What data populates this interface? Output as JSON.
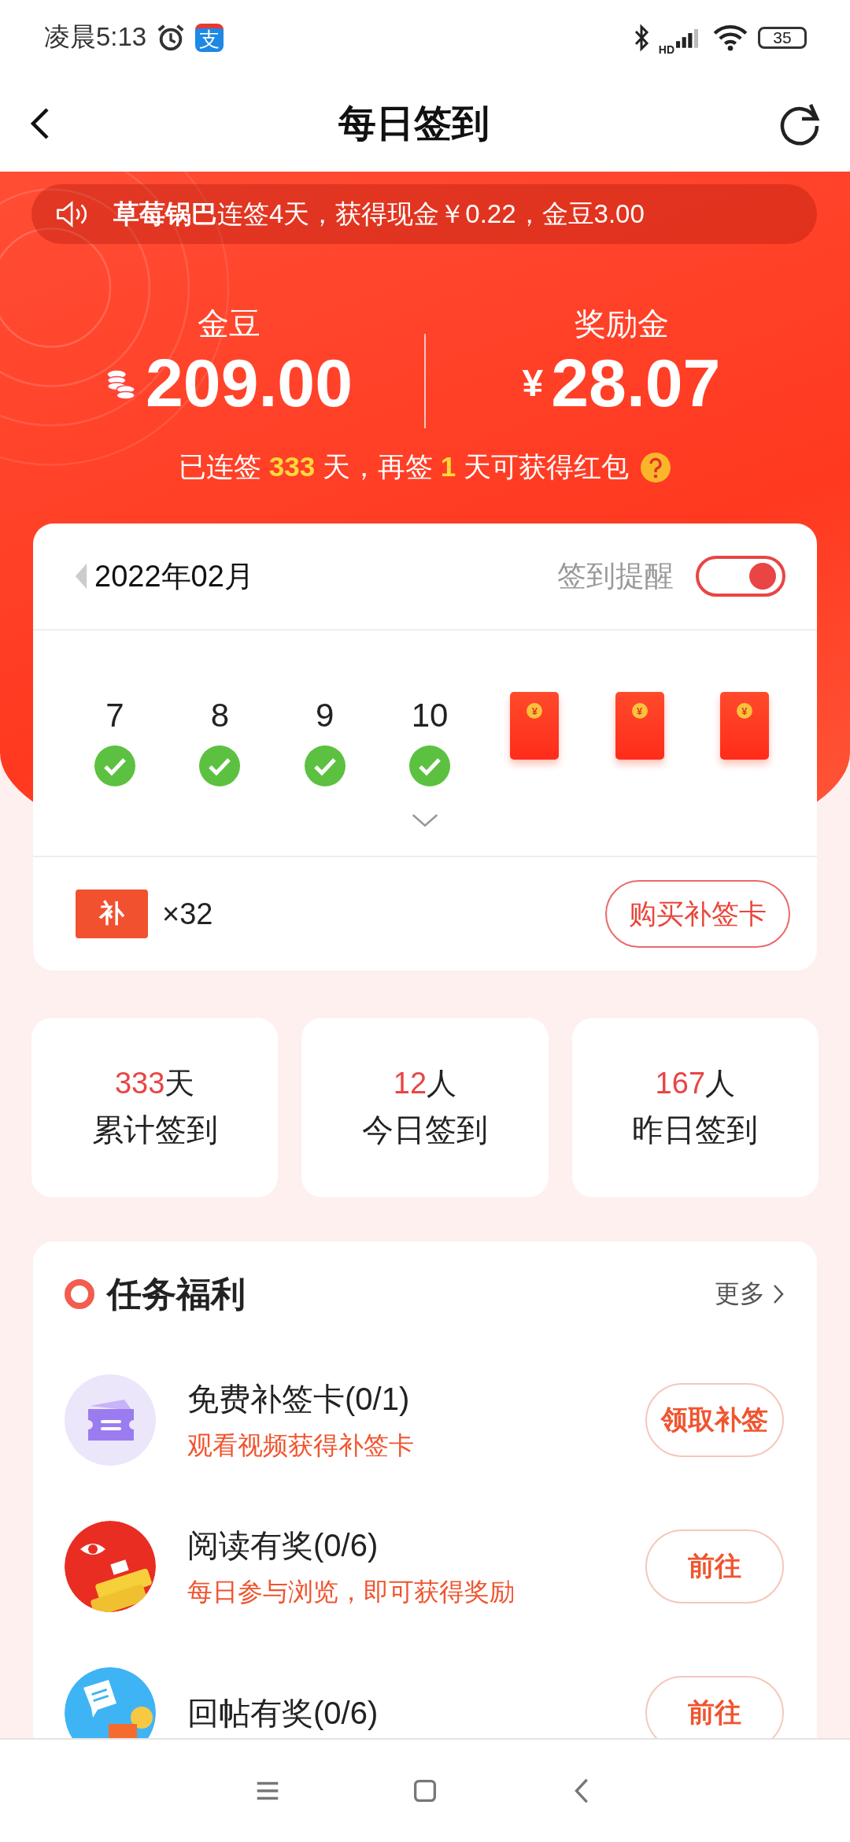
{
  "status_bar": {
    "time": "凌晨5:13",
    "app_icon_text": "支",
    "network_label": "HD",
    "battery": "35"
  },
  "header": {
    "title": "每日签到"
  },
  "ticker": {
    "text": "**草莓锅巴**连签4天，获得现金￥0.22，金豆3.00"
  },
  "balances": [
    {
      "kind": "coins",
      "label": "金豆",
      "value": "209.00"
    },
    {
      "kind": "cash",
      "label": "奖励金",
      "currency": "¥",
      "value": "28.07"
    }
  ],
  "streak": "已连签 **333** 天，再签 **1** 天可获得红包",
  "calendar": {
    "month": "2022年02月",
    "reminder_label": "签到提醒",
    "reminder_on": true,
    "days": [
      {
        "kind": "day",
        "day": "7",
        "checked": true
      },
      {
        "kind": "day",
        "day": "8",
        "checked": true
      },
      {
        "kind": "day",
        "day": "9",
        "checked": true
      },
      {
        "kind": "day",
        "day": "10",
        "checked": true
      },
      {
        "kind": "envelope",
        "symbol": "¥"
      },
      {
        "kind": "envelope",
        "symbol": "¥"
      },
      {
        "kind": "envelope",
        "symbol": "¥"
      }
    ],
    "makeup_card": {
      "icon_text": "补",
      "count": "×32",
      "button": "购买补签卡"
    }
  },
  "stats": [
    {
      "value": "333",
      "unit": "天",
      "label": "累计签到"
    },
    {
      "value": "12",
      "unit": "人",
      "label": "今日签到"
    },
    {
      "value": "167",
      "unit": "人",
      "label": "昨日签到"
    }
  ],
  "tasks": {
    "title": "任务福利",
    "more": "更多",
    "items": [
      {
        "kind": "card",
        "title": "免费补签卡(0/1)",
        "subtitle": "观看视频获得补签卡",
        "action": "领取补签"
      },
      {
        "kind": "read",
        "title": "阅读有奖(0/6)",
        "subtitle": "每日参与浏览，即可获得奖励",
        "action": "前往"
      },
      {
        "kind": "reply",
        "title": "回帖有奖(0/6)",
        "action": "前往"
      }
    ]
  }
}
